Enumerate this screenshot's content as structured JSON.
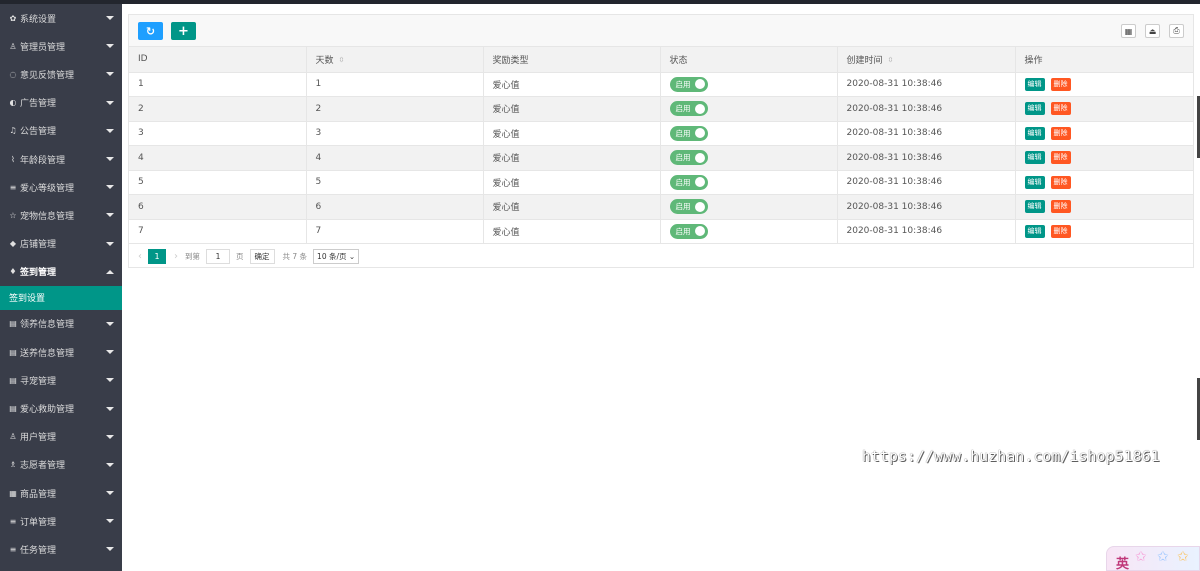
{
  "sidebar": {
    "items": [
      {
        "icon": "gear-icon",
        "glyph": "✿",
        "label": "系统设置"
      },
      {
        "icon": "user-icon",
        "glyph": "♙",
        "label": "管理员管理"
      },
      {
        "icon": "chat-icon",
        "glyph": "◌",
        "label": "意见反馈管理"
      },
      {
        "icon": "ad-icon",
        "glyph": "◐",
        "label": "广告管理"
      },
      {
        "icon": "bell-icon",
        "glyph": "♫",
        "label": "公告管理"
      },
      {
        "icon": "chart-icon",
        "glyph": "⌇",
        "label": "年龄段管理"
      },
      {
        "icon": "list-icon",
        "glyph": "≡",
        "label": "爱心等级管理"
      },
      {
        "icon": "star-icon",
        "glyph": "☆",
        "label": "宠物信息管理"
      },
      {
        "icon": "tag-icon",
        "glyph": "◆",
        "label": "店铺管理"
      },
      {
        "icon": "pin-icon",
        "glyph": "♦",
        "label": "签到管理"
      }
    ],
    "sub_item": "签到设置",
    "items_after": [
      {
        "icon": "card-icon",
        "glyph": "▤",
        "label": "领养信息管理"
      },
      {
        "icon": "card-icon",
        "glyph": "▤",
        "label": "送养信息管理"
      },
      {
        "icon": "card-icon",
        "glyph": "▤",
        "label": "寻宠管理"
      },
      {
        "icon": "card-icon",
        "glyph": "▤",
        "label": "爱心救助管理"
      },
      {
        "icon": "user-icon",
        "glyph": "♙",
        "label": "用户管理"
      },
      {
        "icon": "group-icon",
        "glyph": "♗",
        "label": "志愿者管理"
      },
      {
        "icon": "cart-icon",
        "glyph": "▦",
        "label": "商品管理"
      },
      {
        "icon": "list-icon",
        "glyph": "≡",
        "label": "订单管理"
      },
      {
        "icon": "list-icon",
        "glyph": "≡",
        "label": "任务管理"
      }
    ]
  },
  "toolbar": {
    "refresh_glyph": "↻",
    "add_glyph": "+",
    "right_icons": [
      {
        "name": "columns-icon",
        "glyph": "▦"
      },
      {
        "name": "export-icon",
        "glyph": "⏏"
      },
      {
        "name": "print-icon",
        "glyph": "⎙"
      }
    ]
  },
  "table": {
    "columns": [
      "ID",
      "天数",
      "奖励类型",
      "状态",
      "创建时间",
      "操作"
    ],
    "sort_glyph": "⇳",
    "rows": [
      {
        "id": "1",
        "days": "1",
        "reward": "爱心值",
        "status": "启用",
        "created": "2020-08-31 10:38:46"
      },
      {
        "id": "2",
        "days": "2",
        "reward": "爱心值",
        "status": "启用",
        "created": "2020-08-31 10:38:46"
      },
      {
        "id": "3",
        "days": "3",
        "reward": "爱心值",
        "status": "启用",
        "created": "2020-08-31 10:38:46"
      },
      {
        "id": "4",
        "days": "4",
        "reward": "爱心值",
        "status": "启用",
        "created": "2020-08-31 10:38:46"
      },
      {
        "id": "5",
        "days": "5",
        "reward": "爱心值",
        "status": "启用",
        "created": "2020-08-31 10:38:46"
      },
      {
        "id": "6",
        "days": "6",
        "reward": "爱心值",
        "status": "启用",
        "created": "2020-08-31 10:38:46"
      },
      {
        "id": "7",
        "days": "7",
        "reward": "爱心值",
        "status": "启用",
        "created": "2020-08-31 10:38:46"
      }
    ],
    "edit_label": "编辑",
    "delete_label": "删除"
  },
  "pager": {
    "prev": "‹",
    "current": "1",
    "next": "›",
    "goto_label": "到第",
    "goto_value": "1",
    "page_unit": "页",
    "confirm": "确定",
    "total": "共 7 条",
    "page_size": "10 条/页 ⌄"
  },
  "watermark": "https://www.huzhan.com/ishop51861",
  "ime": {
    "char": "英"
  },
  "colors": {
    "sidebar_bg": "#393d49",
    "accent": "#009688",
    "blue": "#1e9fff",
    "danger": "#ff5722",
    "switch_on": "#5fb878"
  }
}
